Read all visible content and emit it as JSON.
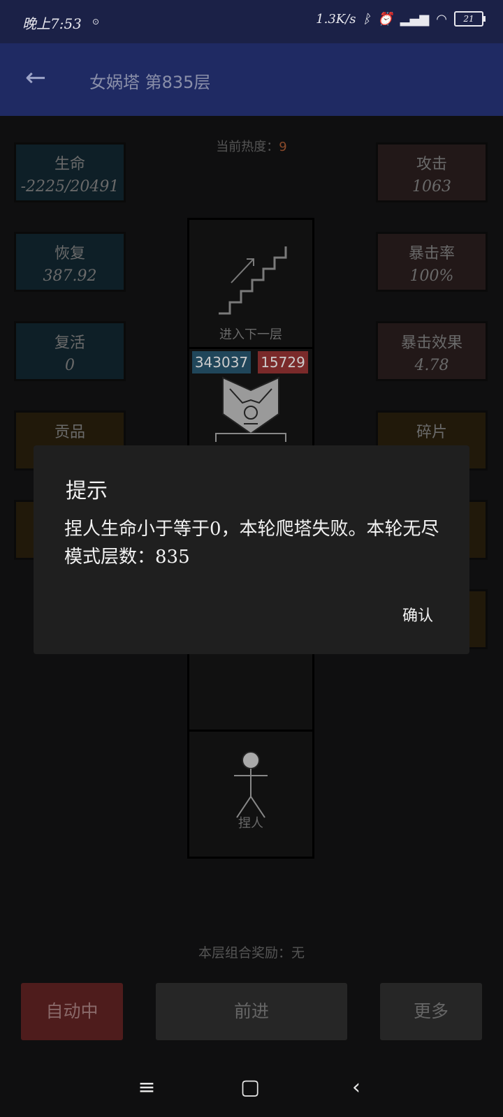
{
  "status_bar": {
    "time": "晚上7:53",
    "net_speed": "1.3K/s",
    "battery": "21"
  },
  "app_bar": {
    "title": "女娲塔 第835层"
  },
  "heat": {
    "label": "当前热度：",
    "value": "9"
  },
  "left_stats": [
    {
      "label": "生命",
      "value": "-2225/20491"
    },
    {
      "label": "恢复",
      "value": "387.92"
    },
    {
      "label": "复活",
      "value": "0"
    },
    {
      "label": "贡品",
      "value": ""
    }
  ],
  "right_stats": [
    {
      "label": "攻击",
      "value": "1063"
    },
    {
      "label": "暴击率",
      "value": "100%"
    },
    {
      "label": "暴击效果",
      "value": "4.78"
    },
    {
      "label": "碎片",
      "value": ""
    }
  ],
  "tower": {
    "next_floor_label": "进入下一层",
    "enemy_hp": "343037",
    "enemy_atk": "15729",
    "player_label": "捏人"
  },
  "dialog": {
    "title": "提示",
    "message": "捏人生命小于等于0，本轮爬塔失败。本轮无尽模式层数：835",
    "confirm": "确认"
  },
  "reward": {
    "text": "本层组合奖励：无"
  },
  "bottom_buttons": {
    "auto": "自动中",
    "forward": "前进",
    "more": "更多"
  }
}
